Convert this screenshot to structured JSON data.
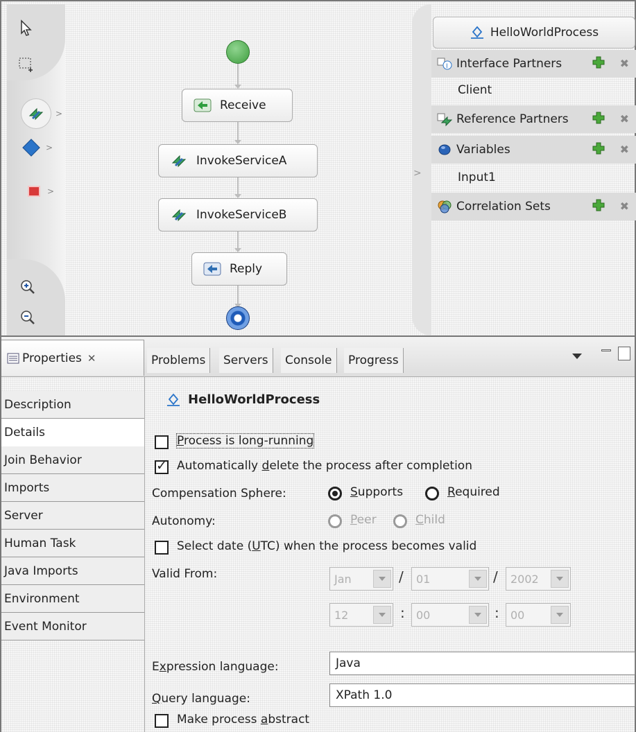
{
  "palette": {
    "tools": [
      {
        "name": "selection-arrow-icon"
      },
      {
        "name": "marquee-select-icon"
      },
      {
        "name": "invoke-activity-icon"
      },
      {
        "name": "choice-diamond-icon"
      },
      {
        "name": "fault-stop-icon"
      },
      {
        "name": "zoom-in-icon"
      },
      {
        "name": "zoom-out-icon"
      }
    ]
  },
  "diagram": {
    "nodes": [
      {
        "label": "Receive",
        "icon": "receive-arrow-icon"
      },
      {
        "label": "InvokeServiceA",
        "icon": "invoke-icon"
      },
      {
        "label": "InvokeServiceB",
        "icon": "invoke-icon"
      },
      {
        "label": "Reply",
        "icon": "reply-arrow-icon"
      }
    ],
    "colors": {
      "start": "#4caf50",
      "end": "#1e5bb8"
    }
  },
  "tray": {
    "process_name": "HelloWorldProcess",
    "sections": [
      {
        "label": "Interface Partners",
        "icon": "interface-partner-icon",
        "items": [
          "Client"
        ]
      },
      {
        "label": "Reference Partners",
        "icon": "reference-partner-icon",
        "items": []
      },
      {
        "label": "Variables",
        "icon": "variable-icon",
        "items": [
          "Input1"
        ]
      },
      {
        "label": "Correlation Sets",
        "icon": "correlation-set-icon",
        "items": []
      }
    ]
  },
  "views": {
    "properties_tab": "Properties",
    "tabs": [
      "Problems",
      "Servers",
      "Console",
      "Progress"
    ]
  },
  "properties": {
    "side_tabs": [
      "Description",
      "Details",
      "Join Behavior",
      "Imports",
      "Server",
      "Human Task",
      "Java Imports",
      "Environment",
      "Event Monitor"
    ],
    "active_tab": "Details",
    "title": "HelloWorldProcess",
    "long_running": {
      "pre": "",
      "u": "P",
      "post": "rocess is long-running",
      "checked": false
    },
    "auto_delete": {
      "pre": "Automatically ",
      "u": "d",
      "post": "elete the process after completion",
      "checked": true
    },
    "compensation": {
      "label": "Compensation Sphere:",
      "supports": {
        "pre": "",
        "u": "S",
        "post": "upports"
      },
      "required": {
        "pre": "",
        "u": "R",
        "post": "equired"
      },
      "selected": "Supports"
    },
    "autonomy": {
      "label": "Autonomy:",
      "peer": {
        "pre": "",
        "u": "P",
        "post": "eer"
      },
      "child": {
        "pre": "",
        "u": "C",
        "post": "hild"
      }
    },
    "select_date": {
      "pre": "Select date (",
      "u": "U",
      "post": "TC) when the process becomes valid",
      "checked": false
    },
    "valid_from": {
      "label": "Valid From:",
      "month": "Jan",
      "day": "01",
      "year": "2002",
      "hour": "12",
      "minute": "00",
      "second": "00",
      "date_sep": "/",
      "time_sep": ":"
    },
    "expression_language": {
      "pre": "E",
      "u": "x",
      "post": "pression language:",
      "value": "Java"
    },
    "query_language": {
      "pre": "",
      "u": "Q",
      "post": "uery language:",
      "value": "XPath 1.0"
    },
    "make_abstract": {
      "pre": "Make process ",
      "u": "a",
      "post": "bstract",
      "checked": false
    }
  }
}
